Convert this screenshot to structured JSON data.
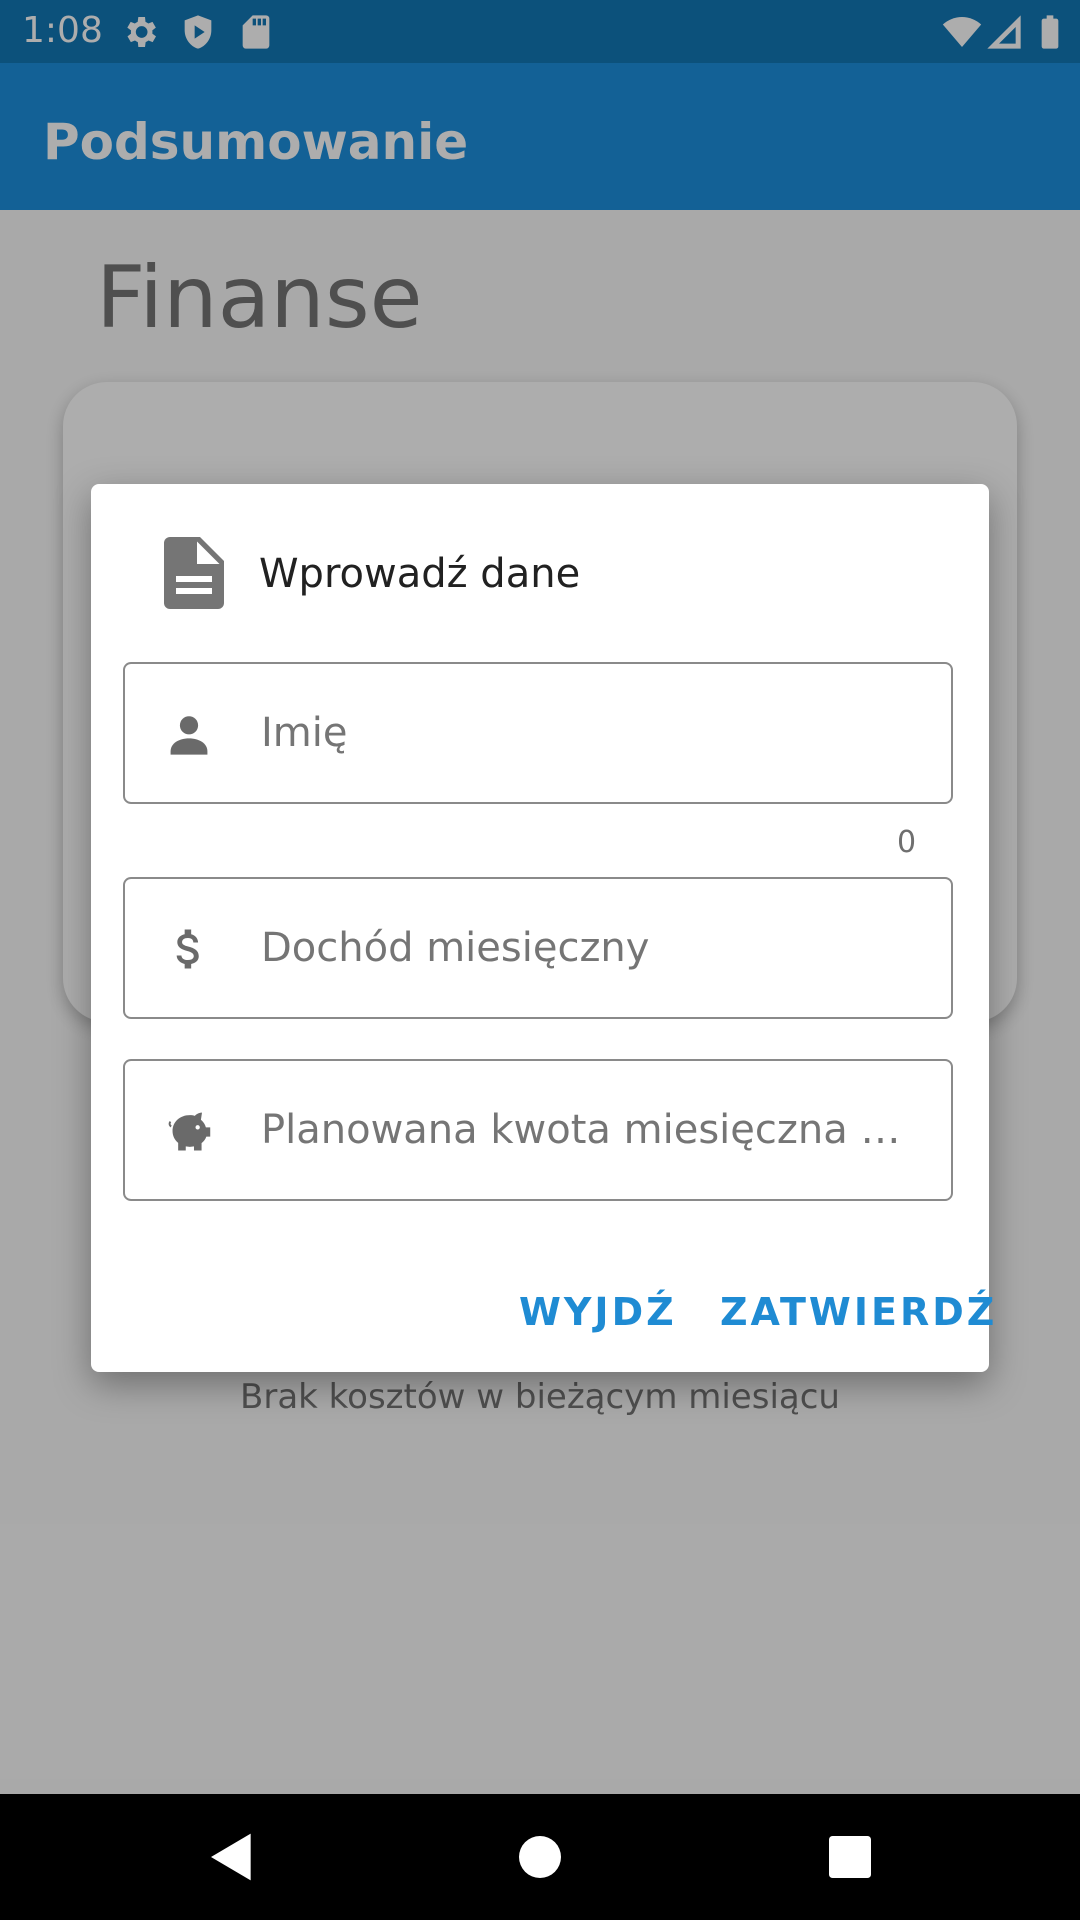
{
  "status_bar": {
    "time": "1:08",
    "icons": [
      "settings-icon",
      "shield-icon",
      "sd-card-icon",
      "wifi-icon",
      "signal-icon",
      "battery-icon"
    ]
  },
  "app_bar": {
    "title": "Podsumowanie"
  },
  "page": {
    "heading": "Finanse",
    "empty_costs_text": "Brak kosztów w bieżącym miesiącu"
  },
  "dialog": {
    "title": "Wprowadź dane",
    "fields": [
      {
        "icon": "person-icon",
        "placeholder": "Imię",
        "value": "",
        "counter": "0"
      },
      {
        "icon": "dollar-icon",
        "placeholder": "Dochód miesięczny",
        "value": ""
      },
      {
        "icon": "piggy-bank-icon",
        "placeholder": "Planowana kwota miesięczna os…",
        "value": ""
      }
    ],
    "buttons": {
      "cancel": "WYJDŹ",
      "confirm": "ZATWIERDŹ"
    }
  },
  "nav_bar": {
    "icons": [
      "back-icon",
      "home-icon",
      "recents-icon"
    ]
  },
  "colors": {
    "status_bar": "#1378b6",
    "app_bar": "#1d8fdd",
    "accent": "#1f8bd3"
  }
}
